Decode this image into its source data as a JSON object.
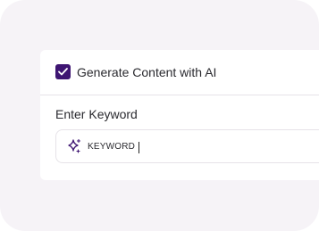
{
  "checkbox": {
    "label": "Generate Content with AI",
    "checked": true,
    "color": "#3e1572"
  },
  "keyword_field": {
    "label": "Enter Keyword",
    "value": "KEYWORD",
    "icon": "sparkle-icon"
  }
}
